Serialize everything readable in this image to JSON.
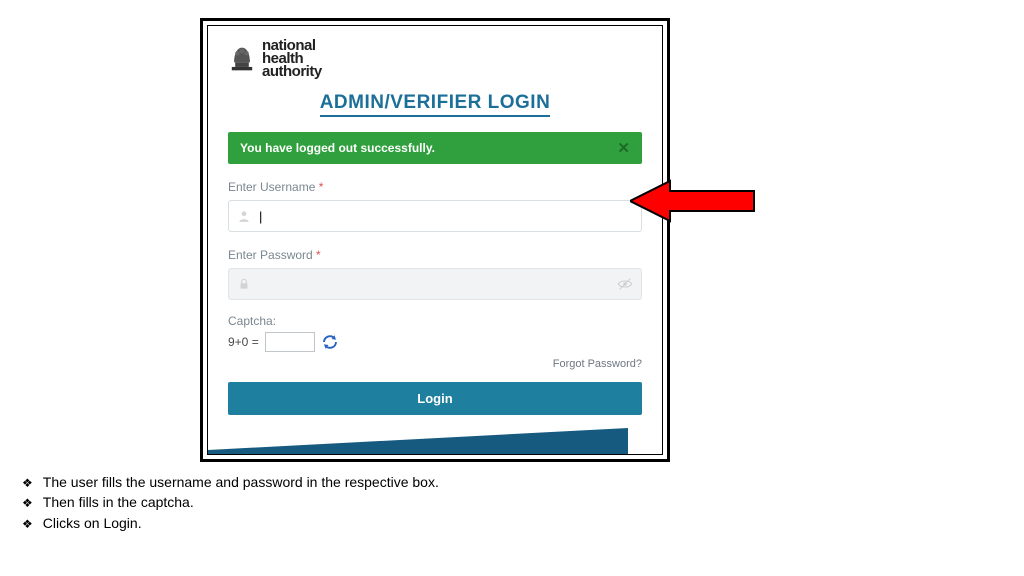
{
  "logo": {
    "line1": "national",
    "line2": "health",
    "line3": "authority"
  },
  "title": "ADMIN/VERIFIER LOGIN",
  "alert": {
    "text": "You have logged out successfully.",
    "close": "✕"
  },
  "username": {
    "label": "Enter Username",
    "req": " *",
    "value": "|"
  },
  "password": {
    "label": "Enter Password",
    "req": " *",
    "value": ""
  },
  "captcha": {
    "label": "Captcha:",
    "challenge": "9+0 ="
  },
  "forgot": "Forgot Password?",
  "login_btn": "Login",
  "notes": {
    "b1": "The user fills the username and password in the respective box.",
    "b2": "Then fills in the captcha.",
    "b3": "Clicks on Login."
  }
}
